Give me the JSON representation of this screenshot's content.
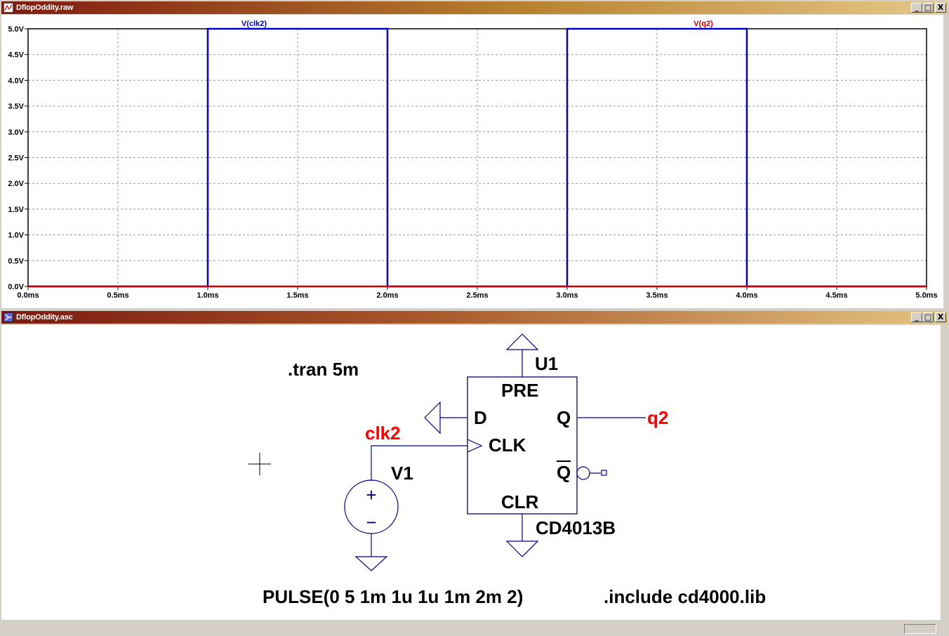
{
  "plot_window": {
    "title": "DflopOddity.raw",
    "buttons": {
      "minimize": "_",
      "maximize": "□",
      "close": "X"
    },
    "legend": [
      "V(clk2)",
      "V(q2)"
    ],
    "y_ticks": [
      "0.0V",
      "0.5V",
      "1.0V",
      "1.5V",
      "2.0V",
      "2.5V",
      "3.0V",
      "3.5V",
      "4.0V",
      "4.5V",
      "5.0V"
    ],
    "x_ticks": [
      "0.0ms",
      "0.5ms",
      "1.0ms",
      "1.5ms",
      "2.0ms",
      "2.5ms",
      "3.0ms",
      "3.5ms",
      "4.0ms",
      "4.5ms",
      "5.0ms"
    ]
  },
  "chart_data": {
    "type": "line",
    "xlabel": "",
    "ylabel": "",
    "xlim": [
      0,
      5
    ],
    "ylim": [
      0,
      5
    ],
    "grid": true,
    "legend_placement": "top",
    "series": [
      {
        "name": "V(clk2)",
        "color": "#0000cc",
        "x": [
          0,
          1.0,
          1.0,
          2.0,
          2.0,
          3.0,
          3.0,
          4.0,
          4.0,
          5.0
        ],
        "y": [
          0,
          0,
          5,
          5,
          0,
          0,
          5,
          5,
          0,
          0
        ]
      },
      {
        "name": "V(q2)",
        "color": "#cc0000",
        "x": [
          0,
          5.0
        ],
        "y": [
          0,
          0
        ]
      }
    ],
    "x_ticks": [
      "0.0ms",
      "0.5ms",
      "1.0ms",
      "1.5ms",
      "2.0ms",
      "2.5ms",
      "3.0ms",
      "3.5ms",
      "4.0ms",
      "4.5ms",
      "5.0ms"
    ],
    "y_ticks": [
      "0.0V",
      "0.5V",
      "1.0V",
      "1.5V",
      "2.0V",
      "2.5V",
      "3.0V",
      "3.5V",
      "4.0V",
      "4.5V",
      "5.0V"
    ]
  },
  "schematic_window": {
    "title": "DflopOddity.asc",
    "buttons": {
      "minimize": "_",
      "maximize": "□",
      "close": "X"
    },
    "directive_tran": ".tran 5m",
    "directive_include": ".include cd4000.lib",
    "source_value": "PULSE(0 5 1m 1u 1u 1m 2m 2)",
    "source_name": "V1",
    "net_clk": "clk2",
    "net_q": "q2",
    "ic_name": "U1",
    "ic_part": "CD4013B",
    "pins": {
      "pre": "PRE",
      "d": "D",
      "clk": "CLK",
      "q": "Q",
      "qbar": "Q",
      "clr": "CLR"
    },
    "source_plus": "+",
    "source_minus": "−",
    "colors": {
      "wire": "#000080",
      "net_label": "#ff0000",
      "text": "#000000"
    }
  }
}
